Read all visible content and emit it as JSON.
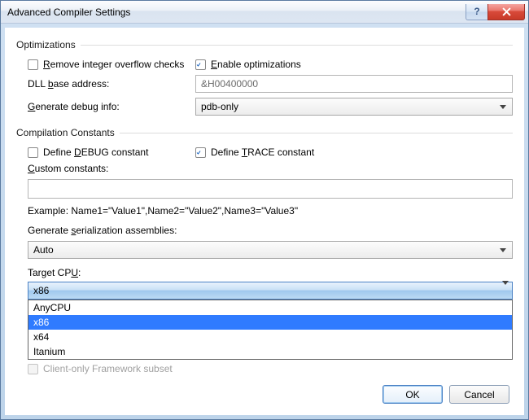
{
  "title": "Advanced Compiler Settings",
  "sections": {
    "optimizations": "Optimizations",
    "compilation": "Compilation Constants"
  },
  "opt": {
    "remove_overflow": {
      "label_pre": "",
      "label_u": "R",
      "label_post": "emove integer overflow checks",
      "checked": false
    },
    "enable_opt": {
      "label_pre": "",
      "label_u": "E",
      "label_post": "nable optimizations",
      "checked": true
    },
    "dll_label_pre": "DLL ",
    "dll_label_u": "b",
    "dll_label_post": "ase address:",
    "dll_value": "&H00400000",
    "dbg_label_pre": "",
    "dbg_label_u": "G",
    "dbg_label_post": "enerate debug info:",
    "dbg_value": "pdb-only"
  },
  "cc": {
    "define_debug": {
      "label_pre": "Define ",
      "label_u": "D",
      "label_post": "EBUG constant",
      "checked": false
    },
    "define_trace": {
      "label_pre": "Define ",
      "label_u": "T",
      "label_post": "RACE constant",
      "checked": true
    },
    "custom_pre": "",
    "custom_u": "C",
    "custom_post": "ustom constants:",
    "custom_value": "",
    "example": "Example: Name1=\"Value1\",Name2=\"Value2\",Name3=\"Value3\"",
    "genser_pre": "Generate ",
    "genser_u": "s",
    "genser_post": "erialization assemblies:",
    "genser_value": "Auto"
  },
  "targetcpu": {
    "label_pre": "Target CP",
    "label_u": "U",
    "label_post": ":",
    "value": "x86",
    "options": [
      "AnyCPU",
      "x86",
      "x64",
      "Itanium"
    ]
  },
  "client_only_label": "Client-only Framework subset",
  "buttons": {
    "ok": "OK",
    "cancel": "Cancel"
  }
}
